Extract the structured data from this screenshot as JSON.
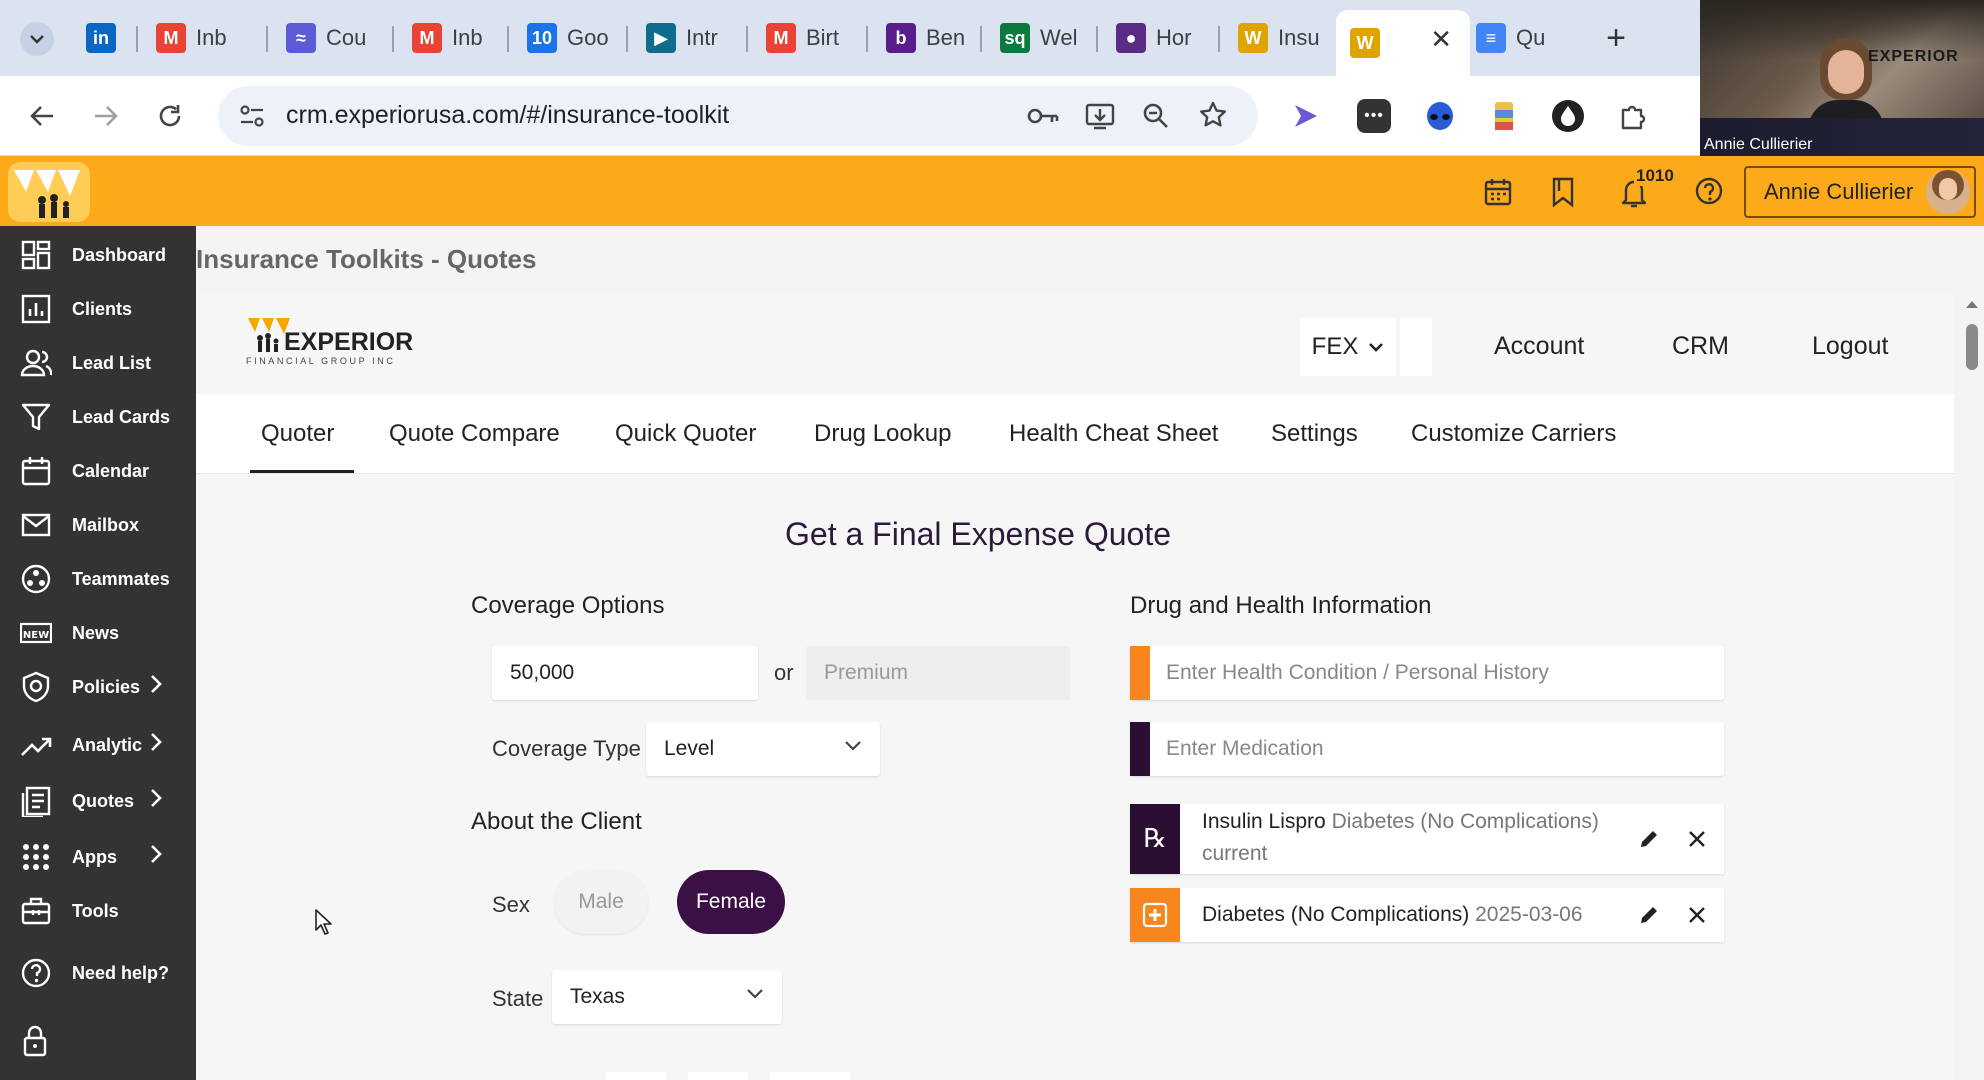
{
  "browser": {
    "tabs": [
      {
        "label": "",
        "icon": "linkedin-icon",
        "color": "#0a66c2"
      },
      {
        "label": "Inb",
        "icon": "gmail-icon",
        "color": "#ea4335"
      },
      {
        "label": "Cou",
        "icon": "app-icon",
        "color": "#5b5bd6"
      },
      {
        "label": "Inb",
        "icon": "gmail-icon",
        "color": "#ea4335"
      },
      {
        "label": "Goo",
        "icon": "calendar-icon",
        "color": "#1a73e8"
      },
      {
        "label": "Intr",
        "icon": "video-icon",
        "color": "#0f6c8c"
      },
      {
        "label": "Birt",
        "icon": "gmail-icon",
        "color": "#ea4335"
      },
      {
        "label": "Ben",
        "icon": "b-icon",
        "color": "#5a1e8c"
      },
      {
        "label": "Wel",
        "icon": "ssq-icon",
        "color": "#0b7a3e"
      },
      {
        "label": "Hor",
        "icon": "circle-app-icon",
        "color": "#5b2c83"
      },
      {
        "label": "Insu",
        "icon": "experior-icon",
        "color": "#e0a400"
      },
      {
        "label": "",
        "icon": "experior-icon",
        "color": "#e0a400",
        "active": true
      },
      {
        "label": "Qu",
        "icon": "list-icon",
        "color": "#4285f4"
      }
    ],
    "url": "crm.experiorusa.com/#/insurance-toolkit"
  },
  "video": {
    "name": "Annie Cullierier",
    "logo": "EXPERIOR"
  },
  "header": {
    "notification_count": "1010",
    "user_name": "Annie Cullierier",
    "accent": "#fcaa1a"
  },
  "sidebar": {
    "items": [
      {
        "label": "Dashboard",
        "icon": "dashboard-icon"
      },
      {
        "label": "Clients",
        "icon": "clients-icon"
      },
      {
        "label": "Lead List",
        "icon": "people-icon"
      },
      {
        "label": "Lead Cards",
        "icon": "filter-icon"
      },
      {
        "label": "Calendar",
        "icon": "calendar-icon"
      },
      {
        "label": "Mailbox",
        "icon": "mail-icon"
      },
      {
        "label": "Teammates",
        "icon": "teammates-icon"
      },
      {
        "label": "News",
        "icon": "news-icon"
      },
      {
        "label": "Policies",
        "icon": "shield-icon",
        "chevron": true
      },
      {
        "label": "Analytic",
        "icon": "trend-icon",
        "chevron": true
      },
      {
        "label": "Quotes",
        "icon": "quotes-icon",
        "chevron": true
      },
      {
        "label": "Apps",
        "icon": "apps-icon",
        "chevron": true
      },
      {
        "label": "Tools",
        "icon": "toolbox-icon"
      },
      {
        "label": "Need help?",
        "icon": "help-icon"
      }
    ]
  },
  "page": {
    "title": "Insurance Toolkits - Quotes",
    "logo_text": "EXPERIOR",
    "logo_sub": "FINANCIAL GROUP INC",
    "product_select": "FEX",
    "links": [
      "Account",
      "CRM",
      "Logout"
    ],
    "tabs": [
      "Quoter",
      "Quote Compare",
      "Quick Quoter",
      "Drug Lookup",
      "Health Cheat Sheet",
      "Settings",
      "Customize Carriers"
    ],
    "active_tab": "Quoter",
    "heading": "Get a Final Expense Quote"
  },
  "form": {
    "coverage_title": "Coverage Options",
    "face_amount": "50,000",
    "or_label": "or",
    "premium_placeholder": "Premium",
    "coverage_type_label": "Coverage Type",
    "coverage_type": "Level",
    "about_title": "About the Client",
    "sex_label": "Sex",
    "sex_options": [
      "Male",
      "Female"
    ],
    "sex_selected": "Female",
    "state_label": "State",
    "state": "Texas",
    "accent_dark": "#3a1045"
  },
  "health": {
    "title": "Drug and Health Information",
    "condition_placeholder": "Enter Health Condition / Personal History",
    "medication_placeholder": "Enter Medication",
    "condition_color": "#f7861e",
    "medication_color": "#2a0f33",
    "entries": [
      {
        "type": "medication",
        "name": "Insulin Lispro",
        "detail": "Diabetes (No Complications)",
        "status": "current"
      },
      {
        "type": "condition",
        "name": "Diabetes (No Complications)",
        "detail": "2025-03-06"
      }
    ]
  }
}
